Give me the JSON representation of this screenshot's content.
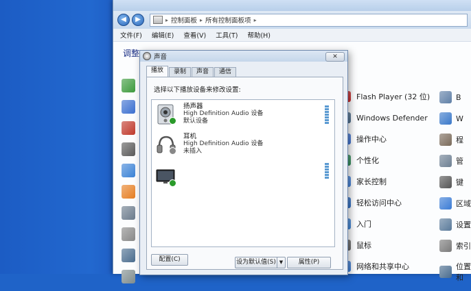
{
  "window": {
    "breadcrumb": [
      "控制面板",
      "所有控制面板项"
    ],
    "menu": [
      "文件(F)",
      "编辑(E)",
      "查看(V)",
      "工具(T)",
      "帮助(H)"
    ],
    "adjust_label": "调整"
  },
  "items_middle": [
    {
      "label": "Flash Player (32 位)",
      "icon": "flash-icon",
      "color": "#c62828"
    },
    {
      "label": "Windows Defender",
      "icon": "defender-icon",
      "color": "#4a6b8a"
    },
    {
      "label": "操作中心",
      "icon": "action-center-flag-icon",
      "color": "#3b6fd0"
    },
    {
      "label": "个性化",
      "icon": "personalization-icon",
      "color": "#2e8b57"
    },
    {
      "label": "家长控制",
      "icon": "parental-controls-icon",
      "color": "#3f7fd8"
    },
    {
      "label": "轻松访问中心",
      "icon": "ease-of-access-icon",
      "color": "#2b6cc4"
    },
    {
      "label": "入门",
      "icon": "getting-started-icon",
      "color": "#3b82d6"
    },
    {
      "label": "鼠标",
      "icon": "mouse-icon",
      "color": "#666666"
    },
    {
      "label": "网络和共享中心",
      "icon": "network-icon",
      "color": "#3a7bd5"
    }
  ],
  "items_right": [
    {
      "label": "B",
      "icon": "bitlocker-icon",
      "color": "#5f7fa6"
    },
    {
      "label": "W",
      "icon": "windows-update-icon",
      "color": "#3a78c9"
    },
    {
      "label": "程",
      "icon": "programs-icon",
      "color": "#7a6a5a"
    },
    {
      "label": "管",
      "icon": "admin-tools-icon",
      "color": "#6d7f92"
    },
    {
      "label": "键",
      "icon": "keyboard-icon",
      "color": "#555555"
    },
    {
      "label": "区域",
      "icon": "region-icon",
      "color": "#3a7bd5"
    },
    {
      "label": "设置",
      "icon": "settings-icon",
      "color": "#5a7a9a"
    },
    {
      "label": "索引",
      "icon": "indexing-icon",
      "color": "#7a7a7a"
    },
    {
      "label": "位置和",
      "icon": "location-icon",
      "color": "#4a6c8e"
    }
  ],
  "left_icon_colors": [
    "#3c9a3c",
    "#3b6fd0",
    "#c0392b",
    "#5a5a5a",
    "#3b82d6",
    "#e67e22",
    "#6b7b8c",
    "#888888",
    "#4a6c8e",
    "#7f8c8d"
  ],
  "dialog": {
    "title": "声音",
    "close_label": "✕",
    "tabs": [
      "播放",
      "录制",
      "声音",
      "通信"
    ],
    "instruction": "选择以下播放设备来修改设置:",
    "devices": [
      {
        "name": "扬声器",
        "driver": "High Definition Audio 设备",
        "status": "默认设备"
      },
      {
        "name": "耳机",
        "driver": "High Definition Audio 设备",
        "status": "未插入"
      }
    ],
    "configure_label": "配置(C)",
    "set_default_label": "设为默认值(S)",
    "properties_label": "属性(P)"
  }
}
